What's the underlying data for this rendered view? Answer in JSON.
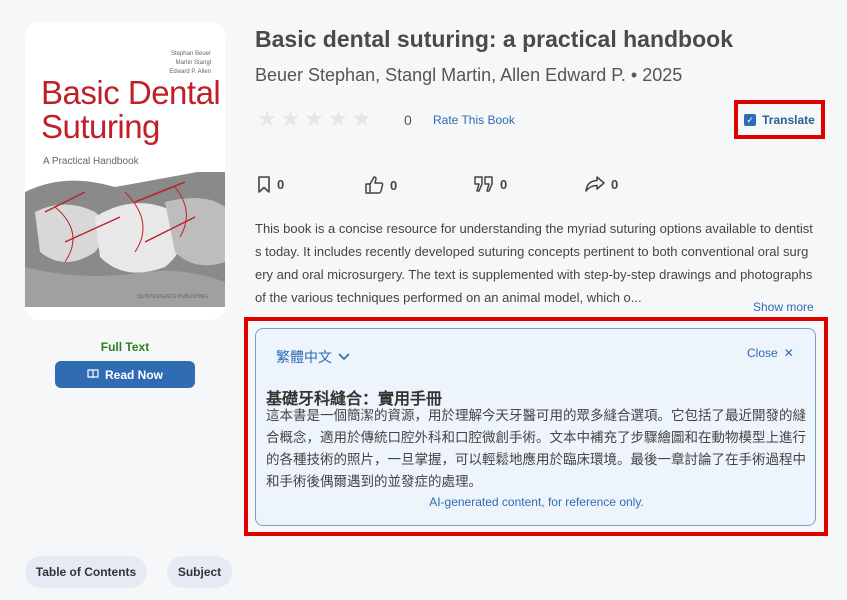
{
  "cover": {
    "authors": [
      "Stephan Beuer",
      "Martin Stangl",
      "Edward P. Allen"
    ],
    "title_line1": "Basic Dental",
    "title_line2": "Suturing",
    "subtitle": "A Practical Handbook",
    "publisher": "QUINTESSENCE PUBLISHING"
  },
  "left": {
    "full_text": "Full Text",
    "read_now": "Read Now"
  },
  "pills": {
    "toc": "Table of Contents",
    "subject": "Subject"
  },
  "book": {
    "title": "Basic dental suturing: a practical handbook",
    "meta": "Beuer Stephan, Stangl Martin, Allen Edward P. • 2025"
  },
  "rating": {
    "count": "0",
    "stars_filled": 0,
    "stars_total": 5,
    "rate_label": "Rate This Book"
  },
  "translate": {
    "label": "Translate",
    "checked": true
  },
  "actions": {
    "bookmark": "0",
    "like": "0",
    "quote": "0",
    "share": "0"
  },
  "description": "This book is a concise resource for understanding the myriad suturing options available to dentists today. It includes recently developed suturing concepts pertinent to both conventional oral surgery and oral microsurgery. The text is supplemented with step-by-step drawings and photographs of the various techniques performed on an animal model, which o...",
  "show_more": "Show more",
  "translation": {
    "language": "繁體中文",
    "close": "Close",
    "title": "基礎牙科縫合：實用手冊",
    "text": "這本書是一個簡潔的資源，用於理解今天牙醫可用的眾多縫合選項。它包括了最近開發的縫合概念，適用於傳統口腔外科和口腔微創手術。文本中補充了步驟繪圖和在動物模型上進行的各種技術的照片，一旦掌握，可以輕鬆地應用於臨床環境。最後一章討論了在手術過程中和手術後偶爾遇到的並發症的處理。",
    "note": "AI-generated content, for reference only."
  },
  "colors": {
    "accent": "#2f6cb4",
    "cover_title": "#c0202a",
    "full_text": "#2e7d20",
    "highlight": "#e00000"
  }
}
